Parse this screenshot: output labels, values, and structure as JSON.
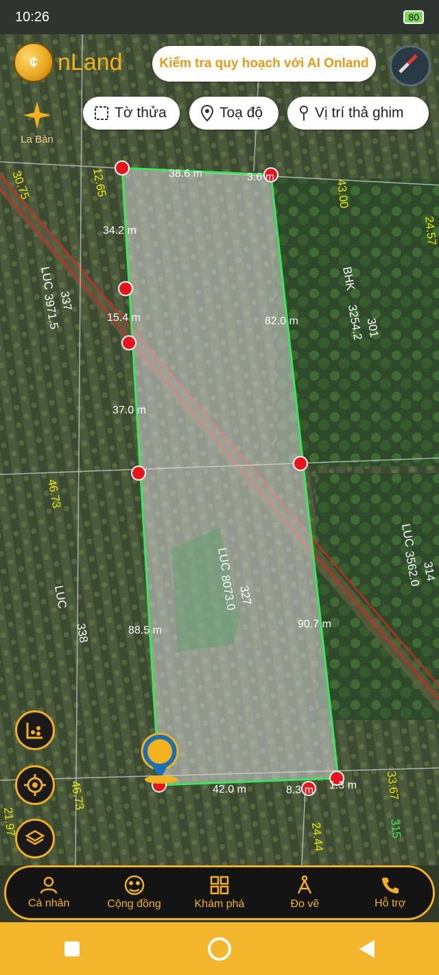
{
  "status_bar": {
    "time": "10:26",
    "battery": "80"
  },
  "app": {
    "logo_text": "nLand",
    "ai_button": "Kiểm tra quy hoạch với AI Onland"
  },
  "chips": [
    {
      "label": "Tờ thửa"
    },
    {
      "label": "Toạ độ"
    },
    {
      "label": "Vị trí thả ghim"
    }
  ],
  "compass_label": "La Bàn",
  "measurements": [
    "38.6 m",
    "3.6 m",
    "34.2 m",
    "15.4 m",
    "37.0 m",
    "88.5 m",
    "82.0 m",
    "90.7 m",
    "42.0 m",
    "8.3 m",
    "1.3 m"
  ],
  "plots": [
    {
      "type": "LUC",
      "number": "337",
      "area": "3971.5"
    },
    {
      "type": "BHK",
      "number": "301",
      "area": "3254.2"
    },
    {
      "type": "LUC",
      "number": "314",
      "area": "3562.0"
    },
    {
      "type": "LUC",
      "number": "338"
    },
    {
      "type": "LUC",
      "number": "327",
      "area": "8073.0"
    }
  ],
  "edge_numbers": [
    "30.75",
    "12.65",
    "43.00",
    "24.57",
    "46.73",
    "46.73",
    "33.67",
    "24.44",
    "21.97",
    "315"
  ],
  "nav": [
    {
      "label": "Cá nhân"
    },
    {
      "label": "Cộng đồng"
    },
    {
      "label": "Khám phá"
    },
    {
      "label": "Đo vẽ"
    },
    {
      "label": "Hỗ trợ"
    }
  ],
  "colors": {
    "accent": "#f3b21d",
    "boundary": "#39e85a",
    "vertex": "#e8141c"
  }
}
